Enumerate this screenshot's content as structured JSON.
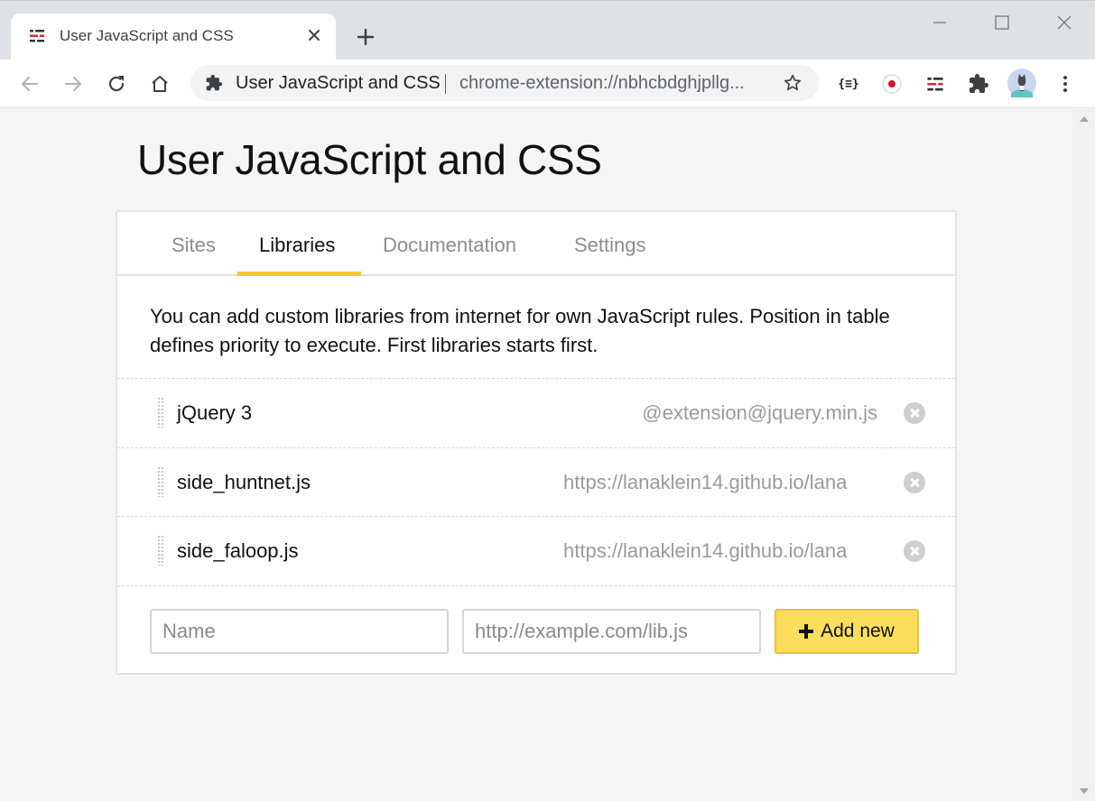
{
  "browser": {
    "tab_title": "User JavaScript and CSS",
    "omnibox_title": "User JavaScript and CSS",
    "omnibox_url": "chrome-extension://nbhcbdghjpllg..."
  },
  "page": {
    "title": "User JavaScript and CSS",
    "tabs": [
      {
        "label": "Sites",
        "active": false
      },
      {
        "label": "Libraries",
        "active": true
      },
      {
        "label": "Documentation",
        "active": false
      },
      {
        "label": "Settings",
        "active": false
      }
    ],
    "description": "You can add custom libraries from internet for own JavaScript rules. Position in table defines priority to execute. First libraries starts first.",
    "libraries": [
      {
        "name": "jQuery 3",
        "url": "@extension@jquery.min.js"
      },
      {
        "name": "side_huntnet.js",
        "url": "https://lanaklein14.github.io/lana"
      },
      {
        "name": "side_faloop.js",
        "url": "https://lanaklein14.github.io/lana"
      }
    ],
    "form": {
      "name_placeholder": "Name",
      "url_placeholder": "http://example.com/lib.js",
      "add_label": "Add new"
    }
  },
  "colors": {
    "accent": "#f5c730",
    "button_bg": "#fddd5c",
    "page_bg": "#f6f5f3"
  }
}
